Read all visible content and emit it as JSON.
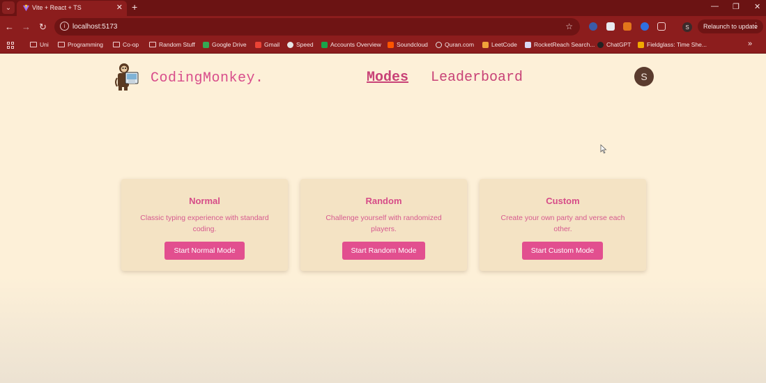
{
  "browser": {
    "tab_title": "Vite + React + TS",
    "url": "localhost:5173",
    "profile_initial": "S",
    "relaunch_label": "Relaunch to update",
    "bookmarks": [
      "Uni",
      "Programming",
      "Co-op",
      "Random Stuff",
      "Google Drive",
      "Gmail",
      "Speed",
      "Accounts Overview",
      "Soundcloud",
      "Quran.com",
      "LeetCode",
      "RocketReach Search...",
      "ChatGPT",
      "Fieldglass: Time She..."
    ]
  },
  "header": {
    "brand": "CodingMonkey.",
    "nav": {
      "modes": "Modes",
      "leaderboard": "Leaderboard"
    },
    "avatar_initial": "S"
  },
  "modes": [
    {
      "title": "Normal",
      "description": "Classic typing experience with standard coding.",
      "button": "Start Normal Mode"
    },
    {
      "title": "Random",
      "description": "Challenge yourself with randomized players.",
      "button": "Start Random Mode"
    },
    {
      "title": "Custom",
      "description": "Create your own party and verse each other.",
      "button": "Start Custom Mode"
    }
  ],
  "colors": {
    "accent": "#e24f8f",
    "page_bg": "#fdf0d8",
    "card_bg": "#f4e3c4",
    "chrome": "#8c1d1d"
  }
}
